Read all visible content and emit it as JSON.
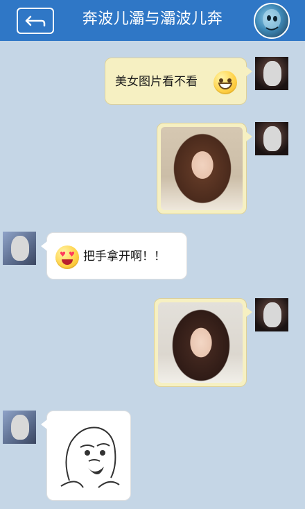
{
  "header": {
    "title": "奔波儿灞与灞波儿奔"
  },
  "messages": [
    {
      "id": 1,
      "sender": "me",
      "type": "text",
      "text": "美女图片看不看",
      "emoji": "grin-emoji"
    },
    {
      "id": 2,
      "sender": "me",
      "type": "image",
      "image": "photo-girl-covering-mouth"
    },
    {
      "id": 3,
      "sender": "friend",
      "type": "text",
      "text": "把手拿开啊！！",
      "emoji": "heart-eyes-emoji"
    },
    {
      "id": 4,
      "sender": "me",
      "type": "image",
      "image": "photo-girl-smiling"
    },
    {
      "id": 5,
      "sender": "friend",
      "type": "image",
      "image": "y-u-no-meme"
    }
  ],
  "colors": {
    "header_bg": "#2f77c6",
    "chat_bg": "#c5d6e6",
    "bubble_out": "#f6f0c2",
    "bubble_in": "#ffffff"
  }
}
